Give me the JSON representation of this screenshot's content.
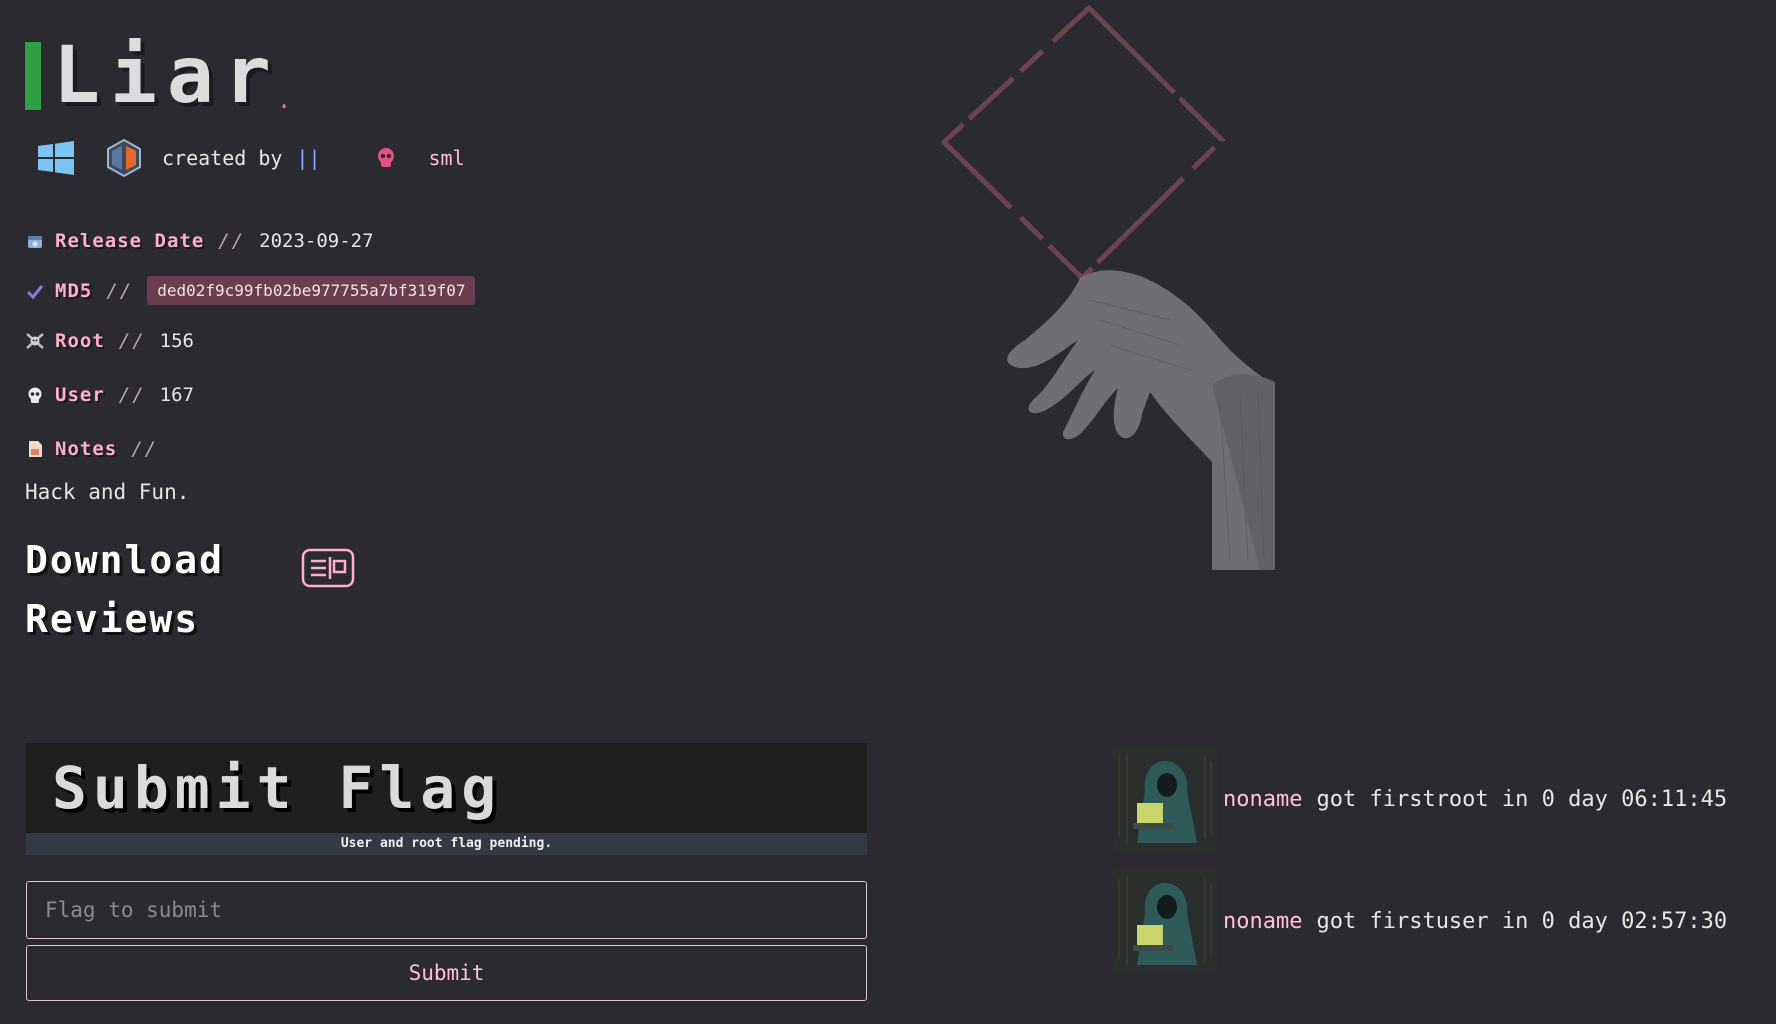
{
  "machine": {
    "title": "Liar",
    "title_dot": "."
  },
  "meta": {
    "os_icon": "windows-icon",
    "difficulty_icon": "hex-shield-icon",
    "created_label": "created by",
    "separator": "||",
    "author_icon": "skull-icon",
    "author": "sml"
  },
  "info": {
    "release": {
      "icon": "calendar-icon",
      "label": "Release Date",
      "slashes": "//",
      "value": "2023-09-27"
    },
    "md5": {
      "icon": "check-icon",
      "label": "MD5",
      "slashes": "//",
      "value": "ded02f9c99fb02be977755a7bf319f07"
    },
    "root": {
      "icon": "crossbones-icon",
      "label": "Root",
      "slashes": "//",
      "value": "156"
    },
    "user": {
      "icon": "skull-icon",
      "label": "User",
      "slashes": "//",
      "value": "167"
    },
    "notes": {
      "icon": "note-icon",
      "label": "Notes",
      "slashes": "//",
      "value": "Hack and Fun."
    }
  },
  "links": {
    "download": "Download",
    "download_icon": "download-card-icon",
    "reviews": "Reviews"
  },
  "flag": {
    "title": "Submit Flag",
    "status": "User and root flag pending.",
    "placeholder": "Flag to submit",
    "submit_label": "Submit"
  },
  "bloods": [
    {
      "avatar": "hacker-avatar",
      "user": "noname",
      "text": "got firstroot in 0 day 06:11:45"
    },
    {
      "avatar": "hacker-avatar",
      "user": "noname",
      "text": "got firstuser in 0 day 02:57:30"
    }
  ],
  "colors": {
    "background": "#2b2a30",
    "accent_pink": "#ffb0cc",
    "title_bar": "#2ea043",
    "md5_bg": "#6a3d4f"
  }
}
